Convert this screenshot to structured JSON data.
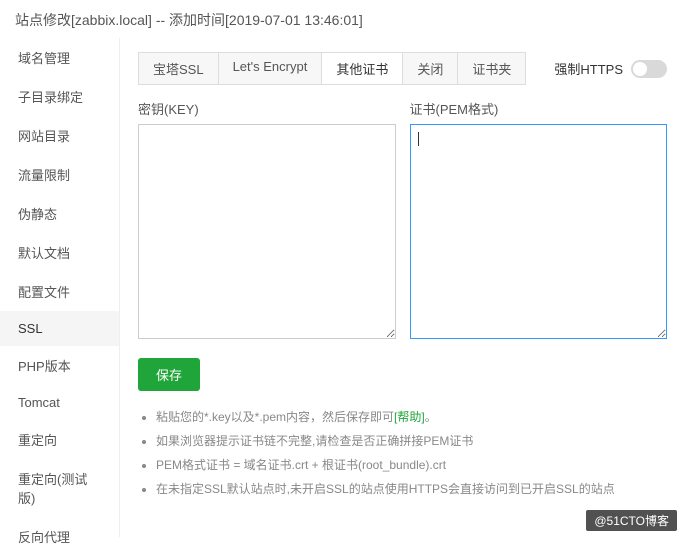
{
  "header": {
    "title": "站点修改[zabbix.local]  --  添加时间[2019-07-01 13:46:01]"
  },
  "sidebar": {
    "items": [
      {
        "label": "域名管理"
      },
      {
        "label": "子目录绑定"
      },
      {
        "label": "网站目录"
      },
      {
        "label": "流量限制"
      },
      {
        "label": "伪静态"
      },
      {
        "label": "默认文档"
      },
      {
        "label": "配置文件"
      },
      {
        "label": "SSL"
      },
      {
        "label": "PHP版本"
      },
      {
        "label": "Tomcat"
      },
      {
        "label": "重定向"
      },
      {
        "label": "重定向(测试版)"
      },
      {
        "label": "反向代理"
      }
    ],
    "activeIndex": 7
  },
  "ssl": {
    "tabs": [
      {
        "label": "宝塔SSL"
      },
      {
        "label": "Let's Encrypt"
      },
      {
        "label": "其他证书"
      },
      {
        "label": "关闭"
      },
      {
        "label": "证书夹"
      }
    ],
    "activeTab": 2,
    "forceHttpsLabel": "强制HTTPS",
    "forceHttpsOn": false,
    "keyLabel": "密钥(KEY)",
    "certLabel": "证书(PEM格式)",
    "keyValue": "",
    "certValue": "",
    "saveLabel": "保存",
    "notes": [
      {
        "prefix": "粘贴您的*.key以及*.pem内容，然后保存即可",
        "linkText": "[帮助]",
        "suffix": "。"
      },
      {
        "text": "如果浏览器提示证书链不完整,请检查是否正确拼接PEM证书"
      },
      {
        "text": "PEM格式证书 = 域名证书.crt + 根证书(root_bundle).crt"
      },
      {
        "text": "在未指定SSL默认站点时,未开启SSL的站点使用HTTPS会直接访问到已开启SSL的站点"
      }
    ]
  },
  "watermark": "@51CTO博客"
}
